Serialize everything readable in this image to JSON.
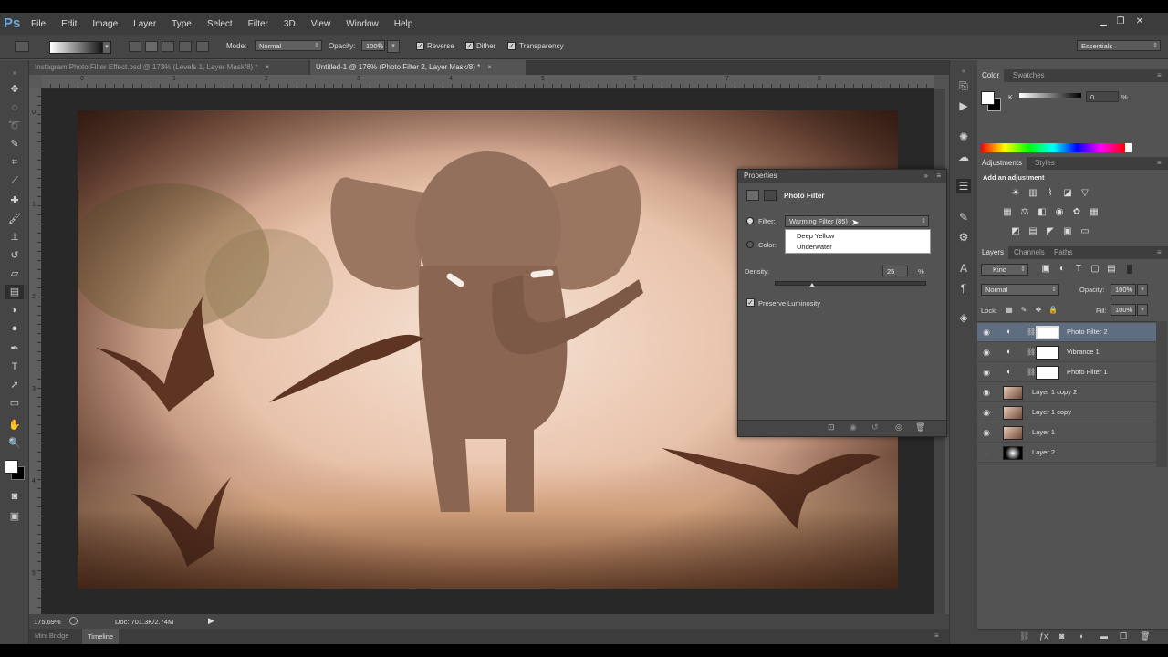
{
  "menubar": {
    "logo": "Ps",
    "items": [
      "File",
      "Edit",
      "Image",
      "Layer",
      "Type",
      "Select",
      "Filter",
      "3D",
      "View",
      "Window",
      "Help"
    ]
  },
  "options": {
    "mode_label": "Mode:",
    "mode_value": "Normal",
    "opacity_label": "Opacity:",
    "opacity_value": "100%",
    "reverse_label": "Reverse",
    "dither_label": "Dither",
    "transparency_label": "Transparency",
    "workspace": "Essentials"
  },
  "doc_tabs": [
    {
      "label": "Instagram Photo Filter Effect.psd @ 173% (Levels 1, Layer Mask/8) *"
    },
    {
      "label": "Untitled-1 @ 176% (Photo Filter 2, Layer Mask/8) *"
    }
  ],
  "ruler_h": [
    "0",
    "1",
    "2",
    "3",
    "4",
    "5",
    "6",
    "7",
    "8"
  ],
  "ruler_v": [
    "0",
    "1",
    "2",
    "3",
    "4",
    "5"
  ],
  "status": {
    "zoom": "175.69%",
    "doc": "Doc: 701.3K/2.74M"
  },
  "bottom_tabs": [
    "Mini Bridge",
    "Timeline"
  ],
  "properties": {
    "title": "Properties",
    "section": "Photo Filter",
    "filter_label": "Filter:",
    "filter_value": "Warming Filter (85)",
    "color_label": "Color:",
    "dropdown_items": [
      "Deep Yellow",
      "Underwater"
    ],
    "density_label": "Density:",
    "density_value": "25",
    "density_unit": "%",
    "density_level": 0.25,
    "preserve_label": "Preserve Luminosity",
    "warm_color": "#ec8a1c"
  },
  "color_panel": {
    "tabs": [
      "Color",
      "Swatches"
    ],
    "k_label": "K",
    "k_value": "0",
    "k_unit": "%"
  },
  "adjustments_panel": {
    "tabs": [
      "Adjustments",
      "Styles"
    ],
    "heading": "Add an adjustment"
  },
  "layers_panel": {
    "tabs": [
      "Layers",
      "Channels",
      "Paths"
    ],
    "kind_label": "Kind",
    "blend_mode": "Normal",
    "opacity_label": "Opacity:",
    "opacity_value": "100%",
    "lock_label": "Lock:",
    "fill_label": "Fill:",
    "fill_value": "100%",
    "layers": [
      {
        "name": "Photo Filter 2"
      },
      {
        "name": "Vibrance 1"
      },
      {
        "name": "Photo Filter 1"
      },
      {
        "name": "Layer 1 copy 2"
      },
      {
        "name": "Layer 1 copy"
      },
      {
        "name": "Layer 1"
      },
      {
        "name": "Layer 2"
      }
    ]
  }
}
